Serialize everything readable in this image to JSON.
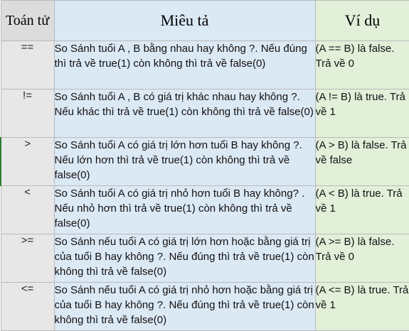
{
  "table": {
    "headers": {
      "operator": "Toán tử",
      "description": "Miêu  tả",
      "example": "Ví dụ"
    },
    "rows": [
      {
        "operator": "==",
        "description": "So Sánh tuổi A , B bằng nhau hay không ?. Nếu đúng thì trả về true(1) còn không thì trả về false(0)",
        "example": "(A == B) là false. Trả về 0"
      },
      {
        "operator": "!=",
        "description": "So Sánh tuổi A , B có giá trị khác nhau hay không ?. Nếu khác thì trả về true(1) còn không thì trả về false(0)",
        "example": "(A != B) là true. Trả về 1"
      },
      {
        "operator": ">",
        "description": "So Sánh tuổi A  có giá trị lớn hơn tuổi B hay không ?. Nếu lớn hơn thì  trả về true(1) còn không thì trả về false(0)",
        "example": "(A > B) là false. Trả về false"
      },
      {
        "operator": "<",
        "description": "So Sánh tuổi A  có giá trị nhỏ hơn tuổi B hay không? . Nếu nhỏ hơn thì  trả về true(1) còn không thì trả về false(0)",
        "example": "(A < B) là true. Trả về 1"
      },
      {
        "operator": ">=",
        "description": "So Sánh nếu tuổi A có giá trị lớn hơn hoặc bằng giá trị của tuổi B hay không ?. Nếu đúng  thì trả về true(1) còn không thì trả về false(0)",
        "example": "(A >= B) là false. Trả về 0"
      },
      {
        "operator": "<=",
        "description": "So Sánh nếu tuổi A có giá trị nhỏ hơn hoặc bằng giá trị của tuổi B hay không ?. Nếu đúng thì trả về true(1) còn không thì trả về false(0)",
        "example": "(A <= B) là true. Trả về 1"
      }
    ]
  }
}
